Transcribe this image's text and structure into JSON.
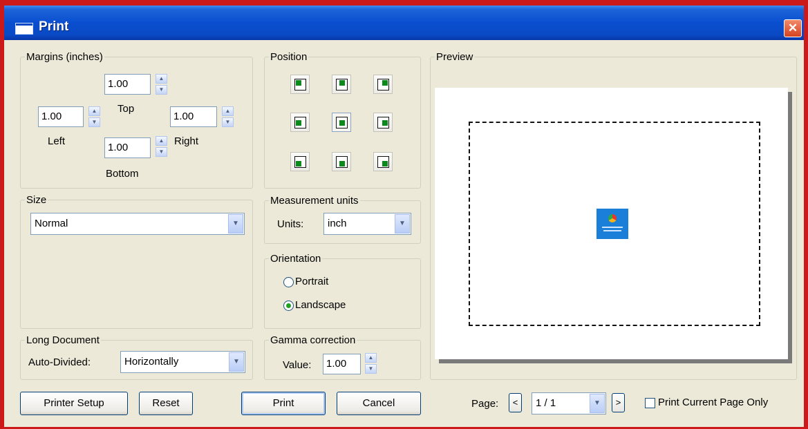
{
  "window": {
    "title": "Print",
    "close": "✕"
  },
  "margins": {
    "legend": "Margins (inches)",
    "top": {
      "label": "Top",
      "value": "1.00"
    },
    "left": {
      "label": "Left",
      "value": "1.00"
    },
    "right": {
      "label": "Right",
      "value": "1.00"
    },
    "bottom": {
      "label": "Bottom",
      "value": "1.00"
    }
  },
  "position": {
    "legend": "Position",
    "selected": "middle-center",
    "options": [
      "top-left",
      "top-center",
      "top-right",
      "middle-left",
      "middle-center",
      "middle-right",
      "bottom-left",
      "bottom-center",
      "bottom-right"
    ]
  },
  "size": {
    "legend": "Size",
    "value": "Normal"
  },
  "measurement": {
    "legend": "Measurement units",
    "label": "Units:",
    "value": "inch"
  },
  "orientation": {
    "legend": "Orientation",
    "portrait": "Portrait",
    "landscape": "Landscape",
    "selected": "Landscape"
  },
  "long_document": {
    "legend": "Long Document",
    "label": "Auto-Divided:",
    "value": "Horizontally"
  },
  "gamma": {
    "legend": "Gamma correction",
    "label": "Value:",
    "value": "1.00"
  },
  "preview": {
    "legend": "Preview"
  },
  "buttons": {
    "printer_setup": "Printer Setup",
    "reset": "Reset",
    "print": "Print",
    "cancel": "Cancel"
  },
  "page": {
    "label": "Page:",
    "prev": "<",
    "value": "1 / 1",
    "next": ">"
  },
  "print_current_only": {
    "label": "Print Current Page Only",
    "checked": false
  },
  "colors": {
    "titlebar": "#0a49c4",
    "position_marker": "#0a8a1a",
    "radio_dot": "#21a121",
    "window_bg": "#ece9d8"
  }
}
